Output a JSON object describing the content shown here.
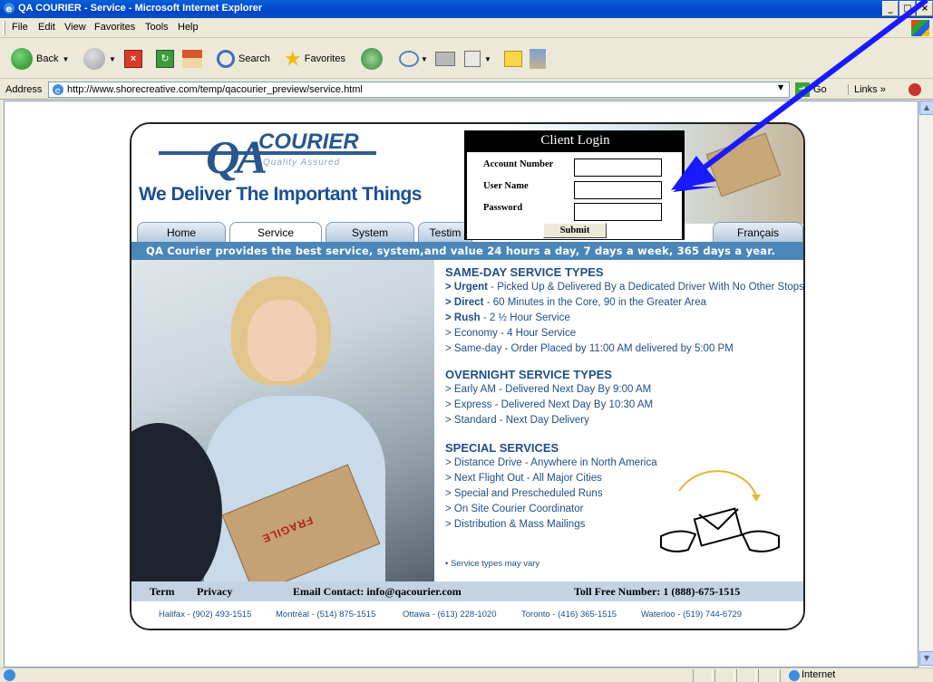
{
  "window": {
    "title": "QA COURIER - Service - Microsoft Internet Explorer",
    "controls": [
      "_",
      "□",
      "×"
    ]
  },
  "menu": [
    "File",
    "Edit",
    "View",
    "Favorites",
    "Tools",
    "Help"
  ],
  "toolbar": {
    "back_label": "Back",
    "search_label": "Search",
    "favorites_label": "Favorites"
  },
  "address": {
    "label": "Address",
    "url": "http://www.shorecreative.com/temp/qacourier_preview/service.html",
    "go_label": "Go",
    "links_label": "Links"
  },
  "status": {
    "zone_label": "Internet"
  },
  "site": {
    "logo": {
      "q": "QA",
      "name": "COURIER",
      "subtitle": "Quality Assured"
    },
    "tagline": "We Deliver The Important Things",
    "nav": [
      "Home",
      "Service",
      "System",
      "Testim",
      "Français"
    ],
    "banner": "QA Courier provides the best service, system,and value 24 hours a day, 7 days a week, 365 days a year.",
    "sections": [
      {
        "title": "SAME-DAY SERVICE TYPES",
        "items": [
          {
            "bold": "> Urgent",
            "text": " - Picked Up & Delivered By a Dedicated Driver With No Other Stops"
          },
          {
            "bold": "> Direct",
            "text": " - 60 Minutes in the Core, 90 in the Greater Area"
          },
          {
            "bold": "> Rush",
            "text": " - 2 ½ Hour Service"
          },
          {
            "bold": "",
            "text": "> Economy - 4 Hour Service"
          },
          {
            "bold": "",
            "text": "> Same-day - Order Placed by 11:00 AM delivered by 5:00 PM"
          }
        ]
      },
      {
        "title": "OVERNIGHT SERVICE TYPES",
        "items": [
          {
            "bold": "",
            "text": "> Early AM - Delivered Next Day By 9:00 AM"
          },
          {
            "bold": "",
            "text": "> Express - Delivered Next Day By 10:30 AM"
          },
          {
            "bold": "",
            "text": "> Standard - Next Day Delivery"
          }
        ]
      },
      {
        "title": "SPECIAL SERVICES",
        "items": [
          {
            "bold": "",
            "text": "> Distance Drive - Anywhere in North America"
          },
          {
            "bold": "",
            "text": "> Next Flight Out - All Major Cities"
          },
          {
            "bold": "",
            "text": "> Special and Prescheduled Runs"
          },
          {
            "bold": "",
            "text": "> On Site Courier Coordinator"
          },
          {
            "bold": "",
            "text": "> Distribution & Mass Mailings"
          }
        ]
      }
    ],
    "note": "• Service types may vary",
    "box_label": "FRAGILE",
    "footer": {
      "term": "Term",
      "privacy": "Privacy",
      "email": "Email Contact: info@qacourier.com",
      "tollfree": "Toll Free Number: 1 (888)-675-1515",
      "cities": [
        "Halifax - (902) 493-1515",
        "Montréal - (514) 875-1515",
        "Ottawa - (613) 228-1020",
        "Toronto - (416) 365-1515",
        "Waterloo - (519) 744-6729"
      ]
    },
    "login": {
      "title": "Client Login",
      "account_label": "Account Number",
      "user_label": "User Name",
      "password_label": "Password",
      "submit_label": "Submit"
    }
  },
  "colors": {
    "brand_blue": "#1d4f86",
    "banner_blue": "#4b86b8",
    "annotation_arrow": "#1a1aff"
  }
}
